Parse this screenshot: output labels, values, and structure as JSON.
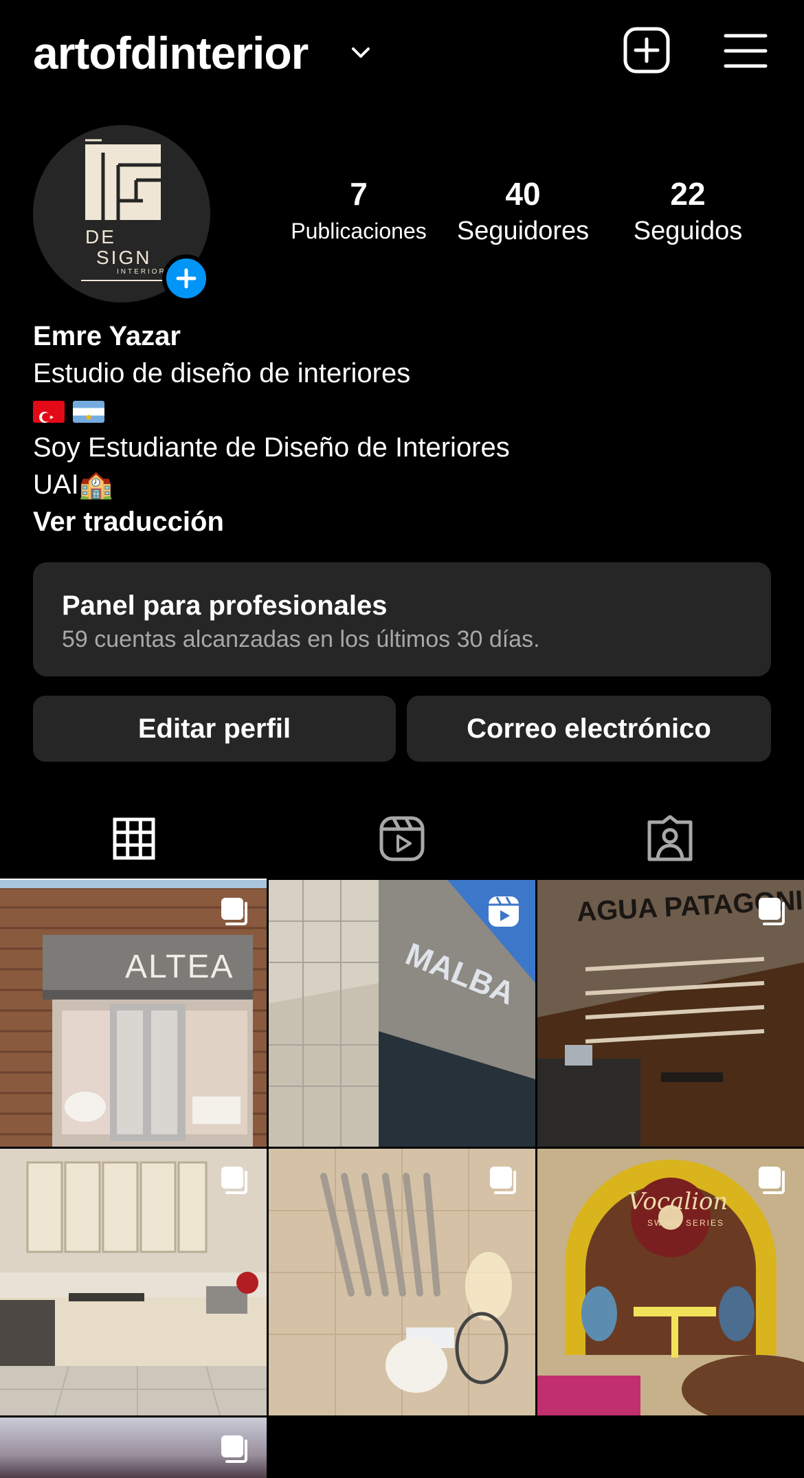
{
  "header": {
    "username": "artofdinterior",
    "icons": [
      "chevron-down-icon",
      "plus-square-icon",
      "menu-icon"
    ]
  },
  "avatar": {
    "logo_lines": [
      "DE",
      "SIGN",
      "INTERIOR"
    ],
    "add_icon": "plus-icon"
  },
  "stats": [
    {
      "value": "7",
      "label": "Publicaciones"
    },
    {
      "value": "40",
      "label": "Seguidores"
    },
    {
      "value": "22",
      "label": "Seguidos"
    }
  ],
  "bio": {
    "name": "Emre Yazar",
    "category": "Estudio de diseño de interiores",
    "line2": "Soy Estudiante de Diseño de Interiores",
    "line3": "UAI🏫",
    "translate_link": "Ver traducción"
  },
  "panel": {
    "title": "Panel para profesionales",
    "subtitle": "59 cuentas alcanzadas en los últimos 30 días."
  },
  "buttons": {
    "edit": "Editar perfil",
    "email": "Correo electrónico"
  },
  "tabs": [
    "grid-icon",
    "reels-icon",
    "tagged-icon"
  ],
  "grid": [
    {
      "caption": "ALTEA",
      "badge": "carousel-icon"
    },
    {
      "caption": "MALBA",
      "badge": "reels-icon"
    },
    {
      "caption": "AGUA PATAGONIA",
      "badge": "carousel-icon"
    },
    {
      "caption": "",
      "badge": "carousel-icon"
    },
    {
      "caption": "",
      "badge": "carousel-icon"
    },
    {
      "caption": "Vocalion",
      "caption_sub": "SWING SERIES",
      "badge": "carousel-icon"
    },
    {
      "caption": "",
      "badge": "carousel-icon"
    }
  ],
  "colors": {
    "background": "#000000",
    "surface": "#262626",
    "accent": "#0095f6",
    "secondary_text": "#a8a8a8"
  }
}
